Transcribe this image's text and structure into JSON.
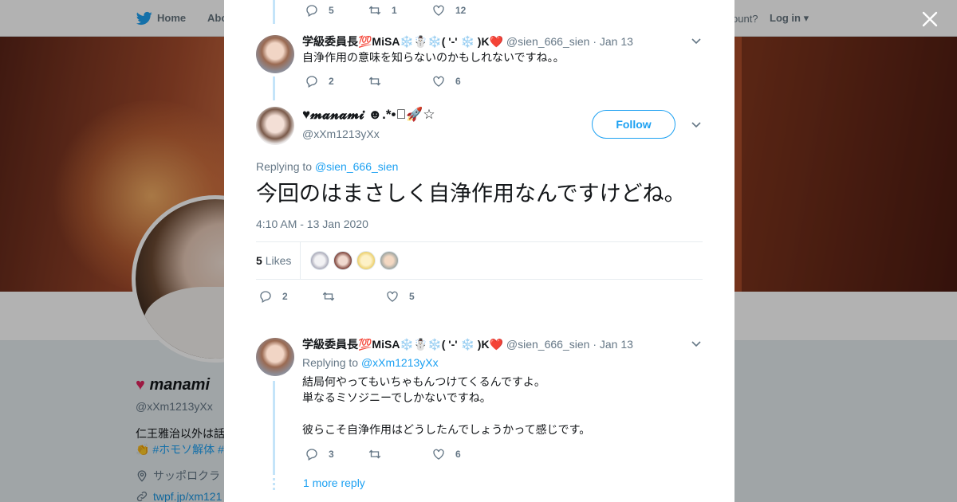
{
  "background": {
    "nav": {
      "home": "Home",
      "about": "Abo",
      "account": "ccount?",
      "login": "Log in"
    },
    "profile": {
      "name": "manami",
      "handle": "@xXm1213yXx",
      "bio_line1": "仁王雅治以外は話",
      "bio_line2": "#ホモソ解体 #",
      "location": "サッポロクラ",
      "url": "twpf.jp/xm121"
    }
  },
  "modal": {
    "top_actions": {
      "replies": "5",
      "retweets": "1",
      "likes": "12"
    },
    "tweet1": {
      "name": "学級委員長💯MiSA❄️☃️❄️( '-' ❄️ )K❤️",
      "handle": "@sien_666_sien",
      "date": "· Jan 13",
      "text": "自浄作用の意味を知らないのかもしれないですね。。",
      "replies": "2",
      "retweets": "",
      "likes": "6"
    },
    "main": {
      "name": "♥𝓶𝓪𝓷𝓪𝓶𝓲 ☻.*•ﾟ🚀☆",
      "handle": "@xXm1213yXx",
      "follow": "Follow",
      "replying_label": "Replying to",
      "replying_handle": "@sien_666_sien",
      "text": "今回のはまさしく自浄作用なんですけどね。",
      "timestamp": "4:10 AM - 13 Jan 2020",
      "likes_count": "5",
      "likes_label": "Likes",
      "replies": "2",
      "retweets": "",
      "likes": "5"
    },
    "tweet3": {
      "name": "学級委員長💯MiSA❄️☃️❄️( '-' ❄️ )K❤️",
      "handle": "@sien_666_sien",
      "date": "· Jan 13",
      "replying_label": "Replying to",
      "replying_handle": "@xXm1213yXx",
      "line1": "結局何やってもいちゃもんつけてくるんですよ。",
      "line2": "単なるミソジニーでしかないですね。",
      "line3": "彼らこそ自浄作用はどうしたんでしょうかって感じです。",
      "replies": "3",
      "retweets": "",
      "likes": "6"
    },
    "more_replies": "1 more reply"
  },
  "colors": {
    "accent": "#1da1f2",
    "thread_line": "#c4e4f9",
    "muted": "#657786"
  }
}
